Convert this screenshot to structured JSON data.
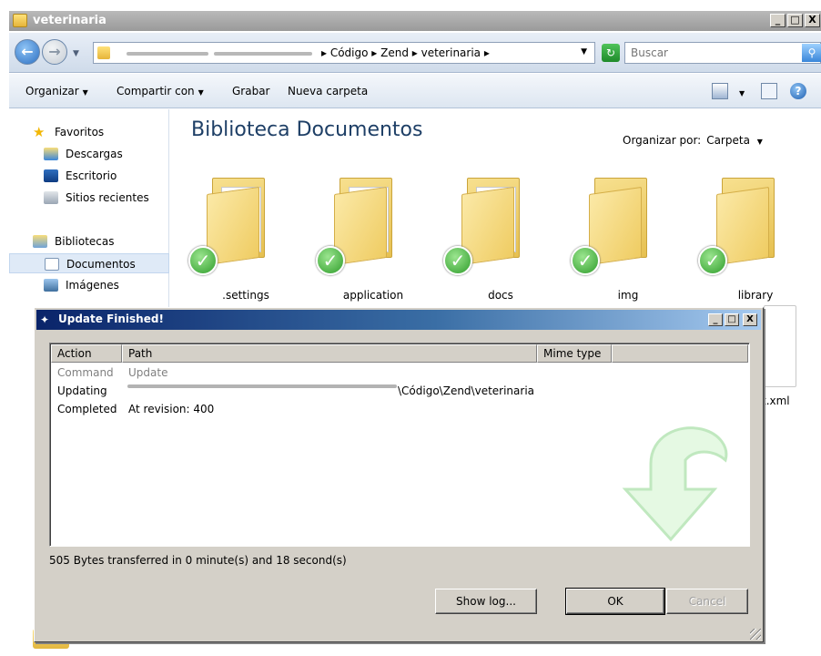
{
  "window": {
    "title": "veterinaria",
    "minimize_label": "_",
    "maximize_label": "□",
    "close_label": "X"
  },
  "address_bar": {
    "crumbs": [
      "Código",
      "Zend",
      "veterinaria"
    ],
    "crumbs_text": "▸ Código ▸ Zend ▸ veterinaria ▸"
  },
  "search": {
    "placeholder": "Buscar"
  },
  "toolbar": {
    "organize_label": "Organizar",
    "share_label": "Compartir con",
    "burn_label": "Grabar",
    "new_folder_label": "Nueva carpeta"
  },
  "sidebar": {
    "items": [
      {
        "label": "Favoritos",
        "icon": "star-icon"
      },
      {
        "label": "Descargas",
        "icon": "downloads-icon"
      },
      {
        "label": "Escritorio",
        "icon": "desktop-icon"
      },
      {
        "label": "Sitios recientes",
        "icon": "recent-places-icon"
      },
      {
        "label": "Bibliotecas",
        "icon": "libraries-icon"
      },
      {
        "label": "Documentos",
        "icon": "documents-icon"
      },
      {
        "label": "Imágenes",
        "icon": "pictures-icon"
      }
    ]
  },
  "content": {
    "library_title": "Biblioteca Documentos",
    "arrange_label": "Organizar por:",
    "arrange_value": "Carpeta",
    "items": [
      {
        "name": ".settings"
      },
      {
        "name": "application"
      },
      {
        "name": "docs"
      },
      {
        "name": "img"
      },
      {
        "name": "library"
      }
    ],
    "partial_file_name": "t.xml"
  },
  "dialog": {
    "title": "Update Finished!",
    "columns": [
      "Action",
      "Path",
      "Mime type"
    ],
    "rows": [
      {
        "action": "Command",
        "path": "Update",
        "muted": true
      },
      {
        "action": "Updating",
        "path": "\\Código\\Zend\\veterinaria",
        "muted": false
      },
      {
        "action": "Completed",
        "path": "At revision: 400",
        "muted": false
      }
    ],
    "status": "505 Bytes transferred in 0 minute(s) and 18 second(s)",
    "buttons": {
      "show_log": "Show log...",
      "ok": "OK",
      "cancel": "Cancel"
    }
  },
  "colors": {
    "dialog_title_start": "#0a246a",
    "dialog_title_end": "#a6caf0",
    "success_green": "#2f9d2b",
    "library_title": "#1e3f66"
  }
}
